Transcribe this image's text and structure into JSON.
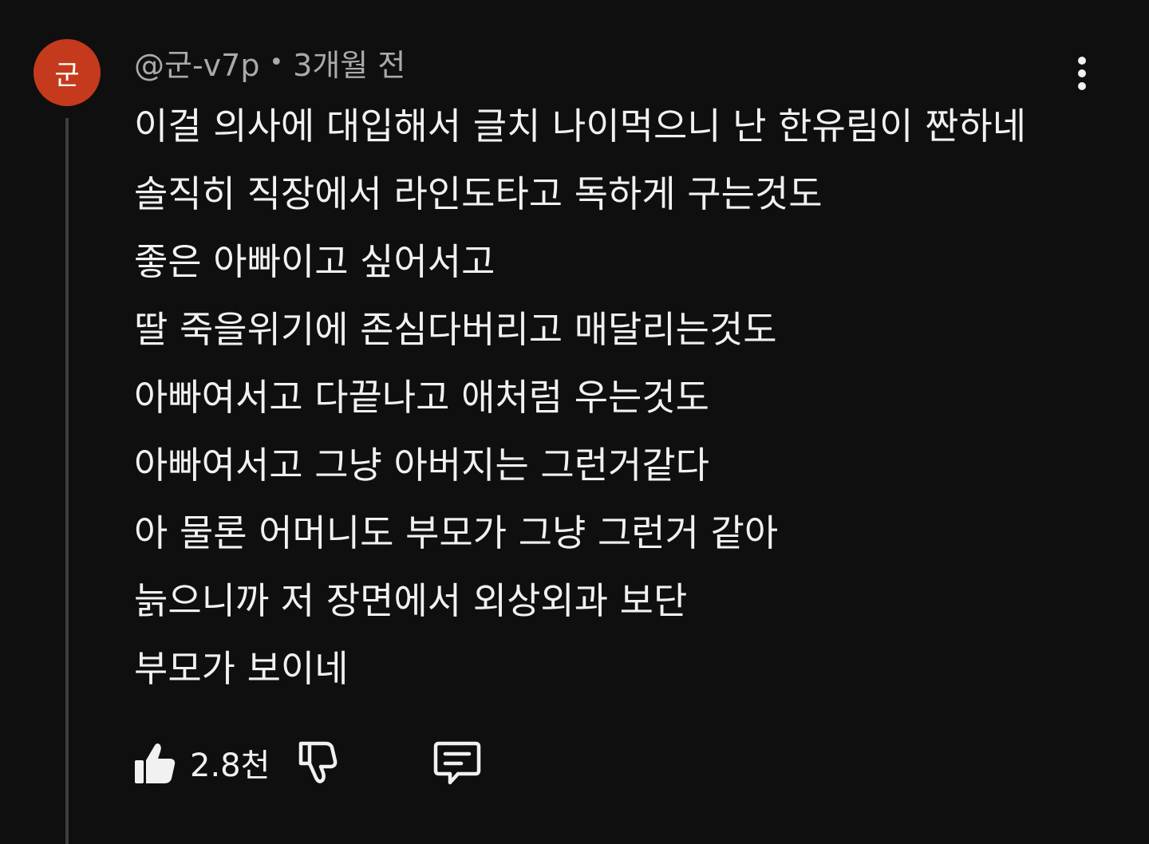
{
  "comment": {
    "avatar_letter": "군",
    "avatar_color": "#c53a1c",
    "author": "@군-v7p",
    "separator": "•",
    "time_ago": "3개월 전",
    "lines": [
      "이걸 의사에 대입해서 글치 나이먹으니 난 한유림이 짠하네",
      "솔직히 직장에서 라인도타고 독하게 구는것도",
      "좋은 아빠이고 싶어서고",
      "딸 죽을위기에 존심다버리고 매달리는것도",
      "아빠여서고 다끝나고 애처럼 우는것도",
      "아빠여서고 그냥 아버지는 그런거같다",
      "아 물론 어머니도 부모가 그냥 그런거 같아",
      "늙으니까 저 장면에서 외상외과 보단",
      "부모가 보이네"
    ],
    "like_count": "2.8천",
    "icons": {
      "like": "thumbs-up-icon",
      "dislike": "thumbs-down-icon",
      "reply": "reply-comment-icon",
      "more": "more-vertical-icon"
    },
    "colors": {
      "background": "#0f0f0f",
      "text": "#f1f1f1",
      "meta_text": "#aaaaaa",
      "thread_line": "#3e3e3e"
    }
  }
}
